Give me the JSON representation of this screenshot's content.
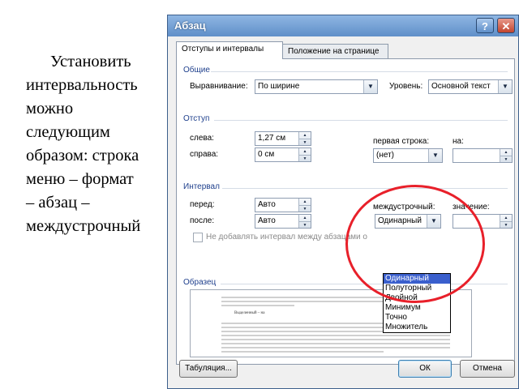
{
  "slide": {
    "lines": [
      "Установить",
      "интервальность",
      "можно",
      "следующим",
      "образом: строка",
      "меню – формат",
      "– абзац –",
      "междустрочный"
    ]
  },
  "dialog": {
    "title": "Абзац",
    "help_glyph": "?",
    "close_glyph": "✕",
    "tabs": [
      "Отступы и интервалы",
      "Положение на странице"
    ],
    "general": {
      "section": "Общие",
      "alignment_label": "Выравнивание:",
      "alignment_value": "По ширине",
      "level_label": "Уровень:",
      "level_value": "Основной текст"
    },
    "indent": {
      "section": "Отступ",
      "left_label": "слева:",
      "left_value": "1,27 см",
      "right_label": "справа:",
      "right_value": "0 см",
      "first_line_label": "первая строка:",
      "first_line_value": "(нет)",
      "by_label": "на:",
      "by_value": ""
    },
    "spacing": {
      "section": "Интервал",
      "before_label": "перед:",
      "before_value": "Авто",
      "after_label": "после:",
      "after_value": "Авто",
      "line_spacing_label": "междустрочный:",
      "line_spacing_value": "Одинарный",
      "at_label": "значение:",
      "at_value": "",
      "no_space_label": "Не добавлять интервал между абзацами о"
    },
    "line_spacing_options": [
      "Одинарный",
      "Полуторный",
      "Двойной",
      "Минимум",
      "Точно",
      "Множитель"
    ],
    "preview": {
      "section": "Образец",
      "sample_text": "Выделенный – на"
    },
    "buttons": {
      "tabs": "Табуляция...",
      "ok": "ОК",
      "cancel": "Отмена"
    }
  },
  "colors": {
    "highlight_ellipse": "#e8202a",
    "section_header": "#1e3f8c",
    "selection": "#3a5fcd"
  }
}
